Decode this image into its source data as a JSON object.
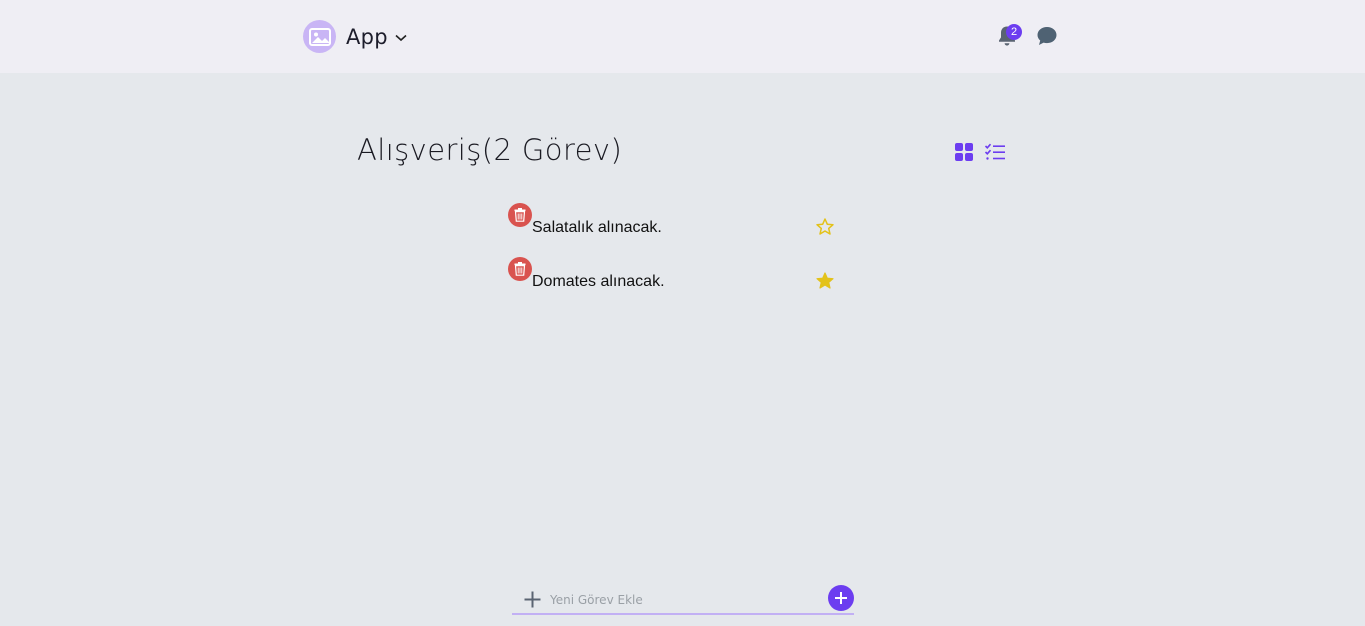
{
  "header": {
    "app_name": "App",
    "notification_count": "2",
    "logo_icon": "image-icon",
    "accent_color": "#6c3df0"
  },
  "list": {
    "title": "Alışveriş(2 Görev)",
    "view_options": [
      "grid-view-icon",
      "checklist-view-icon"
    ]
  },
  "tasks": [
    {
      "text": "Salatalık alınacak.",
      "starred": false
    },
    {
      "text": "Domates alınacak.",
      "starred": true
    }
  ],
  "new_task": {
    "placeholder": "Yeni Görev Ekle"
  },
  "colors": {
    "delete": "#d9534f",
    "star": "#e3c21a",
    "background": "#e5e8ec",
    "topbar": "#efeef4"
  }
}
